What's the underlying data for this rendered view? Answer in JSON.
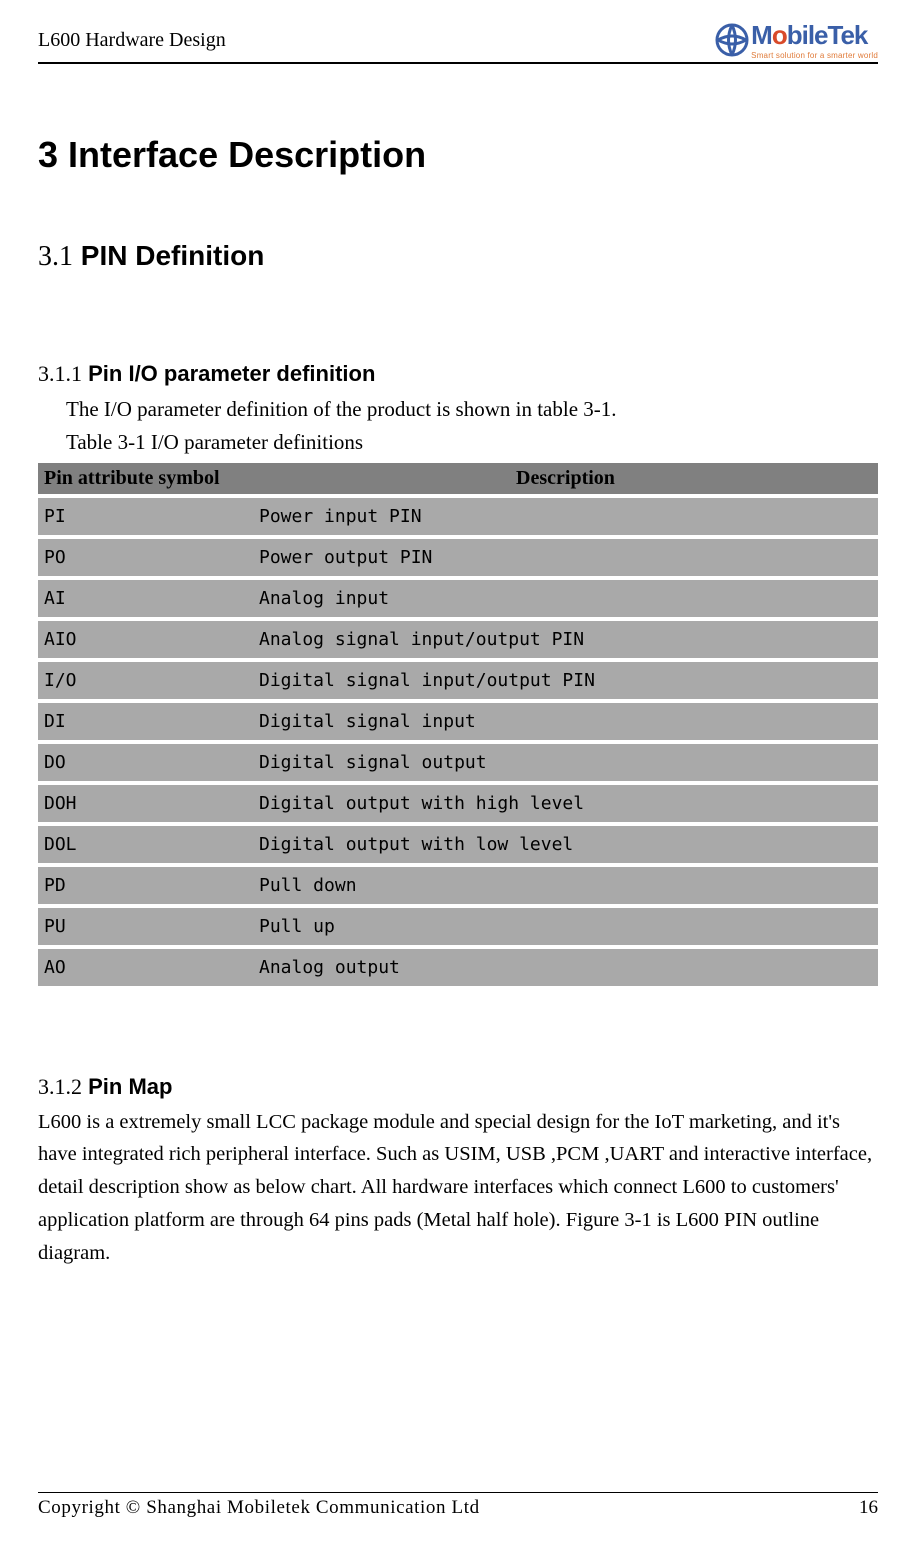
{
  "header": {
    "doc_title": "L600 Hardware Design",
    "logo_text_pre": "M",
    "logo_text_mid": "o",
    "logo_text_post": "bileTek",
    "logo_sub": "Smart  solution  for  a  smarter  world"
  },
  "h1_title": "3 Interface Description",
  "h2_num": "3.1",
  "h2_title": "PIN Definition",
  "h3a_num": "3.1.1",
  "h3a_title": "Pin I/O parameter definition",
  "para_a": "The I/O parameter definition of the product is shown in table 3-1.",
  "table_caption_label": "Table 3-1",
  "table_caption_text": " I/O parameter definitions",
  "table": {
    "head_symbol": "Pin attribute symbol",
    "head_desc": "Description",
    "rows": [
      {
        "sym": "PI",
        "desc": "Power input PIN"
      },
      {
        "sym": "PO",
        "desc": "Power output PIN"
      },
      {
        "sym": "AI",
        "desc": "Analog input"
      },
      {
        "sym": "AIO",
        "desc": "Analog signal input/output PIN"
      },
      {
        "sym": "I/O",
        "desc": "Digital signal input/output PIN"
      },
      {
        "sym": "DI",
        "desc": "Digital signal input"
      },
      {
        "sym": "DO",
        "desc": "Digital signal output"
      },
      {
        "sym": "DOH",
        "desc": "Digital output with high level"
      },
      {
        "sym": "DOL",
        "desc": "Digital output with low level"
      },
      {
        "sym": "PD",
        "desc": "Pull down"
      },
      {
        "sym": "PU",
        "desc": "Pull up"
      },
      {
        "sym": "AO",
        "desc": "Analog output"
      }
    ]
  },
  "h3b_num": "3.1.2",
  "h3b_title": "Pin Map",
  "para_b": "L600 is a extremely small LCC package module and special design for the IoT marketing, and it's have integrated rich peripheral interface. Such as USIM, USB ,PCM ,UART and interactive interface, detail description show as below chart. All hardware interfaces which connect L600 to customers' application platform are through 64 pins pads (Metal half hole). Figure 3-1 is L600 PIN outline diagram.",
  "footer": {
    "left": "Copyright  ©  Shanghai  Mobiletek  Communication  Ltd",
    "page": "16"
  }
}
